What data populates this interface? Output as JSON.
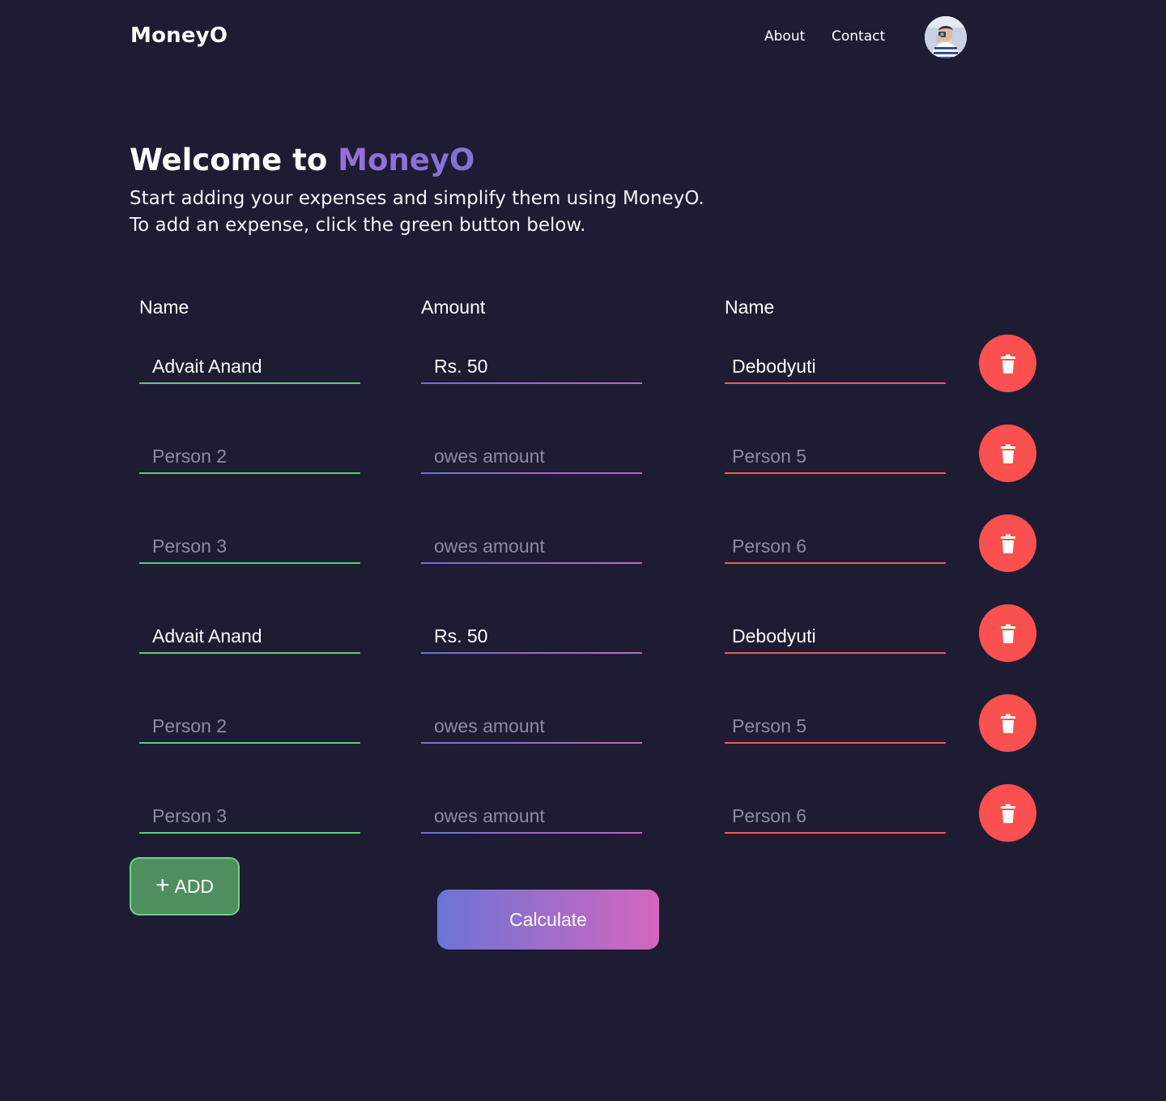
{
  "header": {
    "brand": "MoneyO",
    "nav": [
      {
        "label": "About"
      },
      {
        "label": "Contact"
      }
    ],
    "avatar_icon": "user-avatar"
  },
  "hero": {
    "title_prefix": "Welcome to ",
    "title_accent": "MoneyO",
    "line1": "Start adding your expenses and simplify them using MoneyO.",
    "line2": "To add an expense, click the green button below."
  },
  "table": {
    "headers": [
      "Name",
      "Amount",
      "Name"
    ],
    "rows": [
      {
        "name1": {
          "value": "Advait Anand",
          "placeholder": ""
        },
        "amount": {
          "value": "Rs. 50",
          "placeholder": ""
        },
        "name2": {
          "value": "Debodyuti",
          "placeholder": ""
        }
      },
      {
        "name1": {
          "value": "",
          "placeholder": "Person 2"
        },
        "amount": {
          "value": "",
          "placeholder": "owes amount"
        },
        "name2": {
          "value": "",
          "placeholder": "Person 5"
        }
      },
      {
        "name1": {
          "value": "",
          "placeholder": "Person 3"
        },
        "amount": {
          "value": "",
          "placeholder": "owes amount"
        },
        "name2": {
          "value": "",
          "placeholder": "Person 6"
        }
      },
      {
        "name1": {
          "value": "Advait Anand",
          "placeholder": ""
        },
        "amount": {
          "value": "Rs. 50",
          "placeholder": ""
        },
        "name2": {
          "value": "Debodyuti",
          "placeholder": ""
        }
      },
      {
        "name1": {
          "value": "",
          "placeholder": "Person 2"
        },
        "amount": {
          "value": "",
          "placeholder": "owes amount"
        },
        "name2": {
          "value": "",
          "placeholder": "Person 5"
        }
      },
      {
        "name1": {
          "value": "",
          "placeholder": "Person 3"
        },
        "amount": {
          "value": "",
          "placeholder": "owes amount"
        },
        "name2": {
          "value": "",
          "placeholder": "Person 6"
        }
      }
    ],
    "delete_icon": "trash-icon"
  },
  "actions": {
    "add_plus": "+",
    "add_label": "ADD",
    "calculate_label": "Calculate"
  },
  "colors": {
    "background": "#1e1c33",
    "accent_purple": "#8e6fd6",
    "green": "#5fc879",
    "red": "#fb5050",
    "gradient_start": "#6b74d6",
    "gradient_end": "#d566be"
  }
}
